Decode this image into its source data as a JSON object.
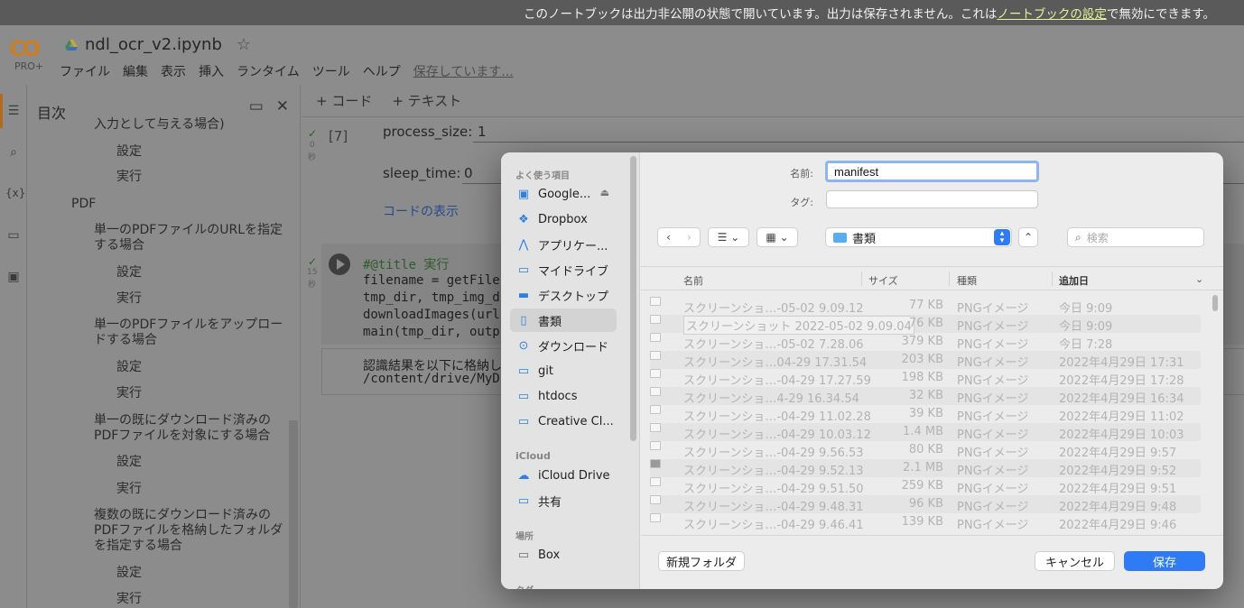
{
  "notice": {
    "text": "このノートブックは出力非公開の状態で開いています。出力は保存されません。これは",
    "link": "ノートブックの設定",
    "suffix": "で無効にできます。"
  },
  "header": {
    "logo": "CO",
    "plan": "PRO+",
    "title": "ndl_ocr_v2.ipynb",
    "menu": [
      "ファイル",
      "編集",
      "表示",
      "挿入",
      "ランタイム",
      "ツール",
      "ヘルプ"
    ],
    "saving": "保存しています..."
  },
  "toc": {
    "title": "目次",
    "items": [
      {
        "label": "入力として与える場合)"
      },
      {
        "label": "設定"
      },
      {
        "label": "実行"
      },
      {
        "label": "PDF"
      },
      {
        "label": "単一のPDFファイルのURLを指定する場合"
      },
      {
        "label": "設定"
      },
      {
        "label": "実行"
      },
      {
        "label": "単一のPDFファイルをアップロードする場合"
      },
      {
        "label": "設定"
      },
      {
        "label": "実行"
      },
      {
        "label": "単一の既にダウンロード済みのPDFファイルを対象にする場合"
      },
      {
        "label": "設定"
      },
      {
        "label": "実行"
      },
      {
        "label": "複数の既にダウンロード済みのPDFファイルを格納したフォルダを指定する場合"
      },
      {
        "label": "設定"
      },
      {
        "label": "実行"
      }
    ]
  },
  "notebook": {
    "add_code": "+ コード",
    "add_text": "+ テキスト",
    "cell1": {
      "exec_num": "[7]",
      "time": "0",
      "unit": "秒",
      "process_size_label": "process_size:",
      "process_size_value": "1",
      "sleep_time_label": "sleep_time:",
      "sleep_time_value": "0",
      "show_code": "コードの表示"
    },
    "cell2": {
      "time": "15",
      "unit": "秒",
      "lines": [
        "#@title 実行",
        "filename = getFileIdAr",
        "tmp_dir, tmp_img_dir",
        "downloadImages(url, t",
        "main(tmp_dir, output_"
      ],
      "output": [
        "認識結果を以下に格納しま",
        "/content/drive/MyDriv"
      ]
    }
  },
  "dialog": {
    "name_label": "名前:",
    "name_value": "manifest",
    "tag_label": "タグ:",
    "location": "書類",
    "search_placeholder": "検索",
    "sidebar": {
      "favorites_title": "よく使う項目",
      "favorites": [
        {
          "label": "Google...",
          "icon": "google-drive-icon"
        },
        {
          "label": "Dropbox",
          "icon": "dropbox-icon"
        },
        {
          "label": "アプリケー...",
          "icon": "applications-icon"
        },
        {
          "label": "マイドライブ",
          "icon": "folder-icon"
        },
        {
          "label": "デスクトップ",
          "icon": "desktop-icon"
        },
        {
          "label": "書類",
          "icon": "document-icon",
          "selected": true
        },
        {
          "label": "ダウンロード",
          "icon": "download-icon"
        },
        {
          "label": "git",
          "icon": "folder-icon"
        },
        {
          "label": "htdocs",
          "icon": "folder-icon"
        },
        {
          "label": "Creative Cl...",
          "icon": "folder-icon"
        }
      ],
      "icloud_title": "iCloud",
      "icloud": [
        {
          "label": "iCloud Drive",
          "icon": "cloud-icon"
        },
        {
          "label": "共有",
          "icon": "shared-folder-icon"
        }
      ],
      "places_title": "場所",
      "places": [
        {
          "label": "Box",
          "icon": "drive-icon"
        }
      ],
      "tags_title": "タグ"
    },
    "columns": {
      "name": "名前",
      "size": "サイズ",
      "kind": "種類",
      "date": "追加日"
    },
    "files": [
      {
        "name": "スクリーンショ…-05-02 9.09.12",
        "size": "77 KB",
        "kind": "PNGイメージ",
        "date": "今日 9:09"
      },
      {
        "name": "スクリーンショット 2022-05-02 9.09.04",
        "size": "76 KB",
        "kind": "PNGイメージ",
        "date": "今日 9:09",
        "editing": true
      },
      {
        "name": "スクリーンショ…-05-02 7.28.06",
        "size": "379 KB",
        "kind": "PNGイメージ",
        "date": "今日 7:28"
      },
      {
        "name": "スクリーンショ…04-29 17.31.54",
        "size": "203 KB",
        "kind": "PNGイメージ",
        "date": "2022年4月29日 17:31"
      },
      {
        "name": "スクリーンショ…-04-29 17.27.59",
        "size": "198 KB",
        "kind": "PNGイメージ",
        "date": "2022年4月29日 17:28"
      },
      {
        "name": "スクリーンショ…4-29 16.34.54",
        "size": "32 KB",
        "kind": "PNGイメージ",
        "date": "2022年4月29日 16:34"
      },
      {
        "name": "スクリーンショ…-04-29 11.02.28",
        "size": "39 KB",
        "kind": "PNGイメージ",
        "date": "2022年4月29日 11:02"
      },
      {
        "name": "スクリーンショ…-04-29 10.03.12",
        "size": "1.4 MB",
        "kind": "PNGイメージ",
        "date": "2022年4月29日 10:03"
      },
      {
        "name": "スクリーンショ…-04-29 9.56.53",
        "size": "80 KB",
        "kind": "PNGイメージ",
        "date": "2022年4月29日 9:57"
      },
      {
        "name": "スクリーンショ…-04-29 9.52.13",
        "size": "2.1 MB",
        "kind": "PNGイメージ",
        "date": "2022年4月29日 9:52"
      },
      {
        "name": "スクリーンショ…-04-29 9.51.50",
        "size": "259 KB",
        "kind": "PNGイメージ",
        "date": "2022年4月29日 9:51"
      },
      {
        "name": "スクリーンショ…-04-29 9.48.31",
        "size": "96 KB",
        "kind": "PNGイメージ",
        "date": "2022年4月29日 9:48"
      },
      {
        "name": "スクリーンショ…-04-29 9.46.41",
        "size": "139 KB",
        "kind": "PNGイメージ",
        "date": "2022年4月29日 9:46"
      }
    ],
    "new_folder": "新規フォルダ",
    "cancel": "キャンセル",
    "save": "保存"
  }
}
